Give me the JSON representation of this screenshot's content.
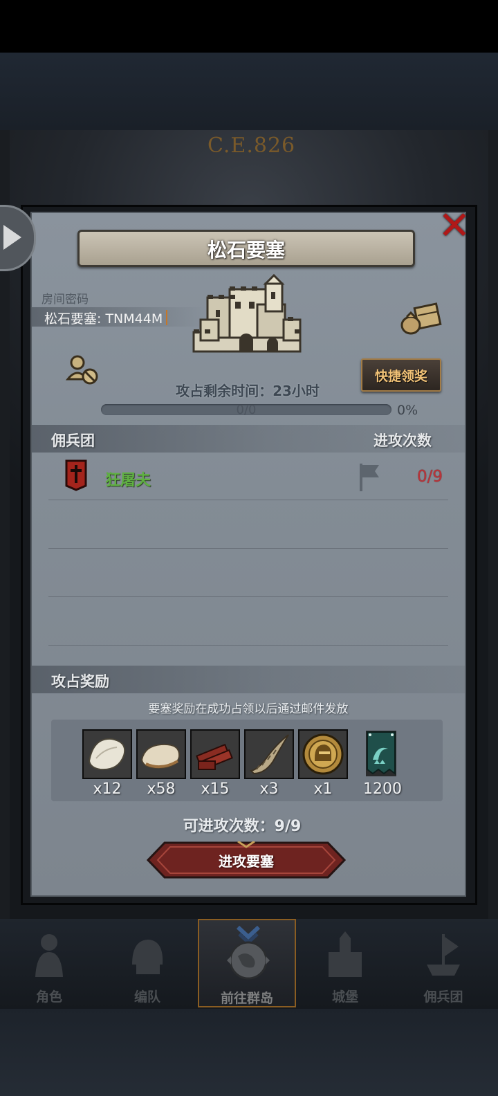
{
  "background": {
    "era_label": "C.E.826"
  },
  "dialog": {
    "title": "松石要塞",
    "room_password_label": "房间密码",
    "room_password_value": "松石要塞: TNM44M",
    "quick_claim_label": "快捷领奖",
    "time_remaining": "攻占剩余时间：23小时",
    "progress": {
      "text": "0/0",
      "percent_text": "0%",
      "fraction": 0
    },
    "mercenary_header": "佣兵团",
    "attack_count_header": "进攻次数",
    "mercenaries": [
      {
        "name": "狂屠夫",
        "attacks": "0/9",
        "color": "#5fb042"
      }
    ],
    "reward_header": "攻占奖励",
    "reward_note": "要塞奖励在成功占领以后通过邮件发放",
    "rewards": [
      {
        "icon": "fur-pelt-icon",
        "qty": "x12"
      },
      {
        "icon": "hide-leather-icon",
        "qty": "x58"
      },
      {
        "icon": "wood-planks-icon",
        "qty": "x15"
      },
      {
        "icon": "horn-icon",
        "qty": "x3"
      },
      {
        "icon": "helmet-medal-icon",
        "qty": "x1"
      },
      {
        "icon": "guild-banner-icon",
        "qty": "1200"
      }
    ],
    "attempts_label": "可进攻次数：9/9",
    "attack_button_label": "进攻要塞"
  },
  "nav": {
    "items": [
      {
        "label": "角色",
        "icon": "knight-icon"
      },
      {
        "label": "编队",
        "icon": "helmet-icon"
      },
      {
        "label": "前往群岛",
        "icon": "globe-icon",
        "active": true
      },
      {
        "label": "城堡",
        "icon": "castle-icon"
      },
      {
        "label": "佣兵团",
        "icon": "ship-icon"
      }
    ]
  },
  "colors": {
    "accent_gold": "#c4772a",
    "danger_red": "#b9343a",
    "merc_green": "#5fb042"
  }
}
